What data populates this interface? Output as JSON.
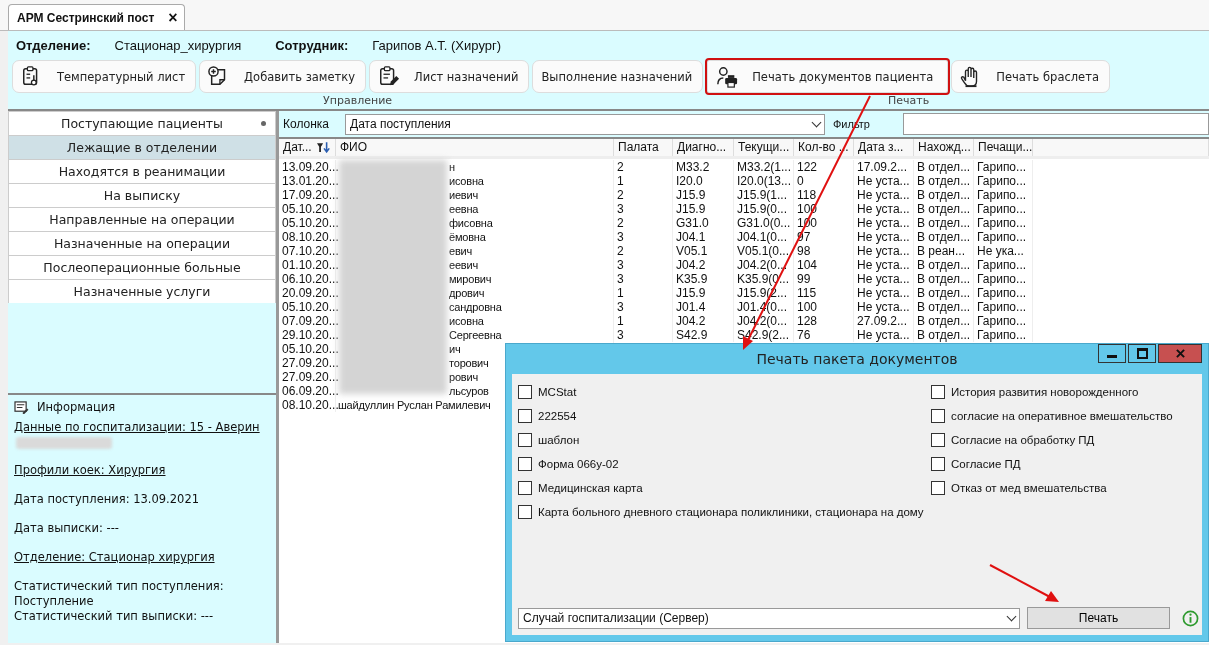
{
  "tab": {
    "title": "АРМ Сестринский пост",
    "close": "×",
    "selected": true
  },
  "header": {
    "department_label": "Отделение:",
    "department": "Стационар_хирургия",
    "employee_label": "Сотрудник:",
    "employee": "Гарипов А.Т. (Хирург)"
  },
  "toolbar_groups": [
    {
      "label": "Управление",
      "buttons": [
        {
          "label": "Температурный лист",
          "highlighted": false
        },
        {
          "label": "Добавить заметку",
          "highlighted": false
        },
        {
          "label": "Лист назначений",
          "highlighted": false
        },
        {
          "label": "Выполнение назначений",
          "highlighted": false
        }
      ]
    },
    {
      "label": "Печать",
      "buttons": [
        {
          "label": "Печать документов пациента",
          "highlighted": true
        },
        {
          "label": "Печать браслета",
          "highlighted": false
        }
      ]
    }
  ],
  "sidebar": {
    "items": [
      {
        "label": "Поступающие пациенты",
        "selected": false,
        "marked": true
      },
      {
        "label": "Лежащие в отделении",
        "selected": true,
        "marked": false
      },
      {
        "label": "Находятся в реанимации",
        "selected": false,
        "marked": false
      },
      {
        "label": "На выписку",
        "selected": false,
        "marked": false
      },
      {
        "label": "Направленные на операции",
        "selected": false,
        "marked": false
      },
      {
        "label": "Назначенные на операции",
        "selected": false,
        "marked": false
      },
      {
        "label": "Послеоперационные больные",
        "selected": false,
        "marked": false
      },
      {
        "label": "Назначенные услуги",
        "selected": false,
        "marked": false
      }
    ]
  },
  "info": {
    "title": "Информация",
    "blocks": [
      [
        {
          "kind": "link",
          "text": "Данные по госпитализации: 15 - Аверин"
        },
        {
          "kind": "blurred"
        }
      ],
      [
        {
          "kind": "link",
          "text": "Профили коек: Хирургия"
        }
      ],
      [
        {
          "kind": "text",
          "text": "Дата поступления: 13.09.2021"
        }
      ],
      [
        {
          "kind": "text",
          "text": "Дата выписки: ---"
        }
      ],
      [
        {
          "kind": "link",
          "text": "Отделение: Стационар хирургия"
        }
      ],
      [
        {
          "kind": "text",
          "text": "Статистический тип поступления: Поступление"
        },
        {
          "kind": "text",
          "text": "Статистический тип выписки: ---"
        }
      ]
    ]
  },
  "filter": {
    "column_label": "Колонка",
    "column_value": "Дата поступления",
    "filter_label": "Фильтр"
  },
  "table": {
    "columns": [
      {
        "label": "Дат...",
        "sorted": true
      },
      {
        "label": "ФИО",
        "sorted": false
      },
      {
        "label": "Палата",
        "sorted": false
      },
      {
        "label": "Диагно...",
        "sorted": false
      },
      {
        "label": "Текущи...",
        "sorted": false
      },
      {
        "label": "Кол-во ...",
        "sorted": false
      },
      {
        "label": "Дата з...",
        "sorted": false
      },
      {
        "label": "Нахожд...",
        "sorted": false
      },
      {
        "label": "Печащи...",
        "sorted": false
      }
    ],
    "rows": [
      {
        "redacted": true,
        "cells": [
          "13.09.20...",
          "н",
          "2",
          "M33.2",
          "M33.2(1...",
          "122",
          "17.09.2...",
          "В отдел...",
          "Гарипо..."
        ]
      },
      {
        "redacted": true,
        "cells": [
          "13.01.20...",
          "исовна",
          "1",
          "I20.0",
          "I20.0(13...",
          "0",
          "Не уста...",
          "В отдел...",
          "Гарипо..."
        ]
      },
      {
        "redacted": true,
        "cells": [
          "17.09.20...",
          "иевич",
          "2",
          "J15.9",
          "J15.9(1...",
          "118",
          "Не уста...",
          "В отдел...",
          "Гарипо..."
        ]
      },
      {
        "redacted": true,
        "cells": [
          "05.10.20...",
          "еевна",
          "3",
          "J15.9",
          "J15.9(0...",
          "100",
          "Не уста...",
          "В отдел...",
          "Гарипо..."
        ]
      },
      {
        "redacted": true,
        "cells": [
          "05.10.20...",
          "фисовна",
          "2",
          "G31.0",
          "G31.0(0...",
          "100",
          "Не уста...",
          "В отдел...",
          "Гарипо..."
        ]
      },
      {
        "redacted": true,
        "cells": [
          "08.10.20...",
          "ёмовна",
          "3",
          "J04.1",
          "J04.1(0...",
          "97",
          "Не уста...",
          "В отдел...",
          "Гарипо..."
        ]
      },
      {
        "redacted": true,
        "cells": [
          "07.10.20...",
          "евич",
          "2",
          "V05.1",
          "V05.1(0...",
          "98",
          "Не уста...",
          "В реан...",
          "Не ука..."
        ]
      },
      {
        "redacted": true,
        "cells": [
          "01.10.20...",
          "еевич",
          "3",
          "J04.2",
          "J04.2(0...",
          "104",
          "Не уста...",
          "В отдел...",
          "Гарипо..."
        ]
      },
      {
        "redacted": true,
        "cells": [
          "06.10.20...",
          "мирович",
          "3",
          "K35.9",
          "K35.9(0...",
          "99",
          "Не уста...",
          "В отдел...",
          "Гарипо..."
        ]
      },
      {
        "redacted": true,
        "cells": [
          "20.09.20...",
          "дрович",
          "1",
          "J15.9",
          "J15.9(2...",
          "115",
          "Не уста...",
          "В отдел...",
          "Гарипо..."
        ]
      },
      {
        "redacted": true,
        "cells": [
          "05.10.20...",
          "сандровна",
          "3",
          "J01.4",
          "J01.4(0...",
          "100",
          "Не уста...",
          "В отдел...",
          "Гарипо..."
        ]
      },
      {
        "redacted": true,
        "cells": [
          "07.09.20...",
          "исовна",
          "1",
          "J04.2",
          "J04.2(0...",
          "128",
          "27.09.2...",
          "В отдел...",
          "Гарипо..."
        ]
      },
      {
        "redacted": true,
        "cells": [
          "29.10.20...",
          "Сергеевна",
          "3",
          "S42.9",
          "S42.9(2...",
          "76",
          "Не уста...",
          "В отдел...",
          "Гарипо..."
        ]
      },
      {
        "redacted": true,
        "cells": [
          "05.10.20...",
          "ич"
        ]
      },
      {
        "redacted": true,
        "cells": [
          "27.09.20...",
          "торович"
        ]
      },
      {
        "redacted": true,
        "cells": [
          "27.09.20...",
          "рович"
        ]
      },
      {
        "redacted": true,
        "cells": [
          "06.09.20...",
          "льсуров"
        ]
      },
      {
        "redacted": false,
        "cells": [
          "08.10.20...",
          "шайдуллин Руслан Рамилевич"
        ]
      }
    ]
  },
  "dialog": {
    "title": "Печать пакета документов",
    "options_left": [
      {
        "label": "MCStat",
        "checked": false
      },
      {
        "label": "222554",
        "checked": false
      },
      {
        "label": "шаблон",
        "checked": false
      },
      {
        "label": "Форма 066у-02",
        "checked": false
      },
      {
        "label": "Медицинская карта",
        "checked": false
      },
      {
        "label": "Карта больного дневного стационара поликлиники, стационара на дому",
        "checked": false
      }
    ],
    "options_right": [
      {
        "label": "История развития новорожденного",
        "checked": false
      },
      {
        "label": "согласие на оперативное вмешательство",
        "checked": false
      },
      {
        "label": "Согласие на обработку ПД",
        "checked": false
      },
      {
        "label": "Согласие ПД",
        "checked": false
      },
      {
        "label": "Отказ от мед вмешательства",
        "checked": false
      }
    ],
    "source_select": "Случай госпитализации (Сервер)",
    "print_button": "Печать"
  }
}
